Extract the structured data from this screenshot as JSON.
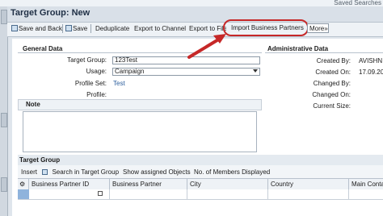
{
  "header": {
    "saved_searches": "Saved Searches",
    "title": "Target Group: New"
  },
  "toolbar": {
    "save_and_back": "Save and Back",
    "save": "Save",
    "deduplicate": "Deduplicate",
    "export_channel": "Export to Channel",
    "export_file": "Export to File",
    "import_bp": "Import Business Partners",
    "more": "More"
  },
  "general": {
    "heading": "General Data",
    "target_group_label": "Target Group:",
    "target_group_value": "123Test",
    "usage_label": "Usage:",
    "usage_value": "Campaign",
    "profile_set_label": "Profile Set:",
    "profile_set_value": "Test",
    "profile_label": "Profile:"
  },
  "admin": {
    "heading": "Administrative Data",
    "created_by_label": "Created By:",
    "created_by_value": "AVISHNI",
    "created_on_label": "Created On:",
    "created_on_value": "17.09.20",
    "changed_by_label": "Changed By:",
    "changed_on_label": "Changed On:",
    "current_size_label": "Current Size:"
  },
  "note": {
    "heading": "Note"
  },
  "target_group": {
    "heading": "Target Group",
    "insert": "Insert",
    "search": "Search in Target Group",
    "show_assigned": "Show assigned Objects",
    "no_members": "No. of Members Displayed",
    "columns": [
      "Business Partner ID",
      "Business Partner",
      "City",
      "Country",
      "Main Conta"
    ]
  },
  "colors": {
    "accent": "#c62828",
    "link": "#2a5d9c",
    "selection": "#8fb3dc"
  }
}
